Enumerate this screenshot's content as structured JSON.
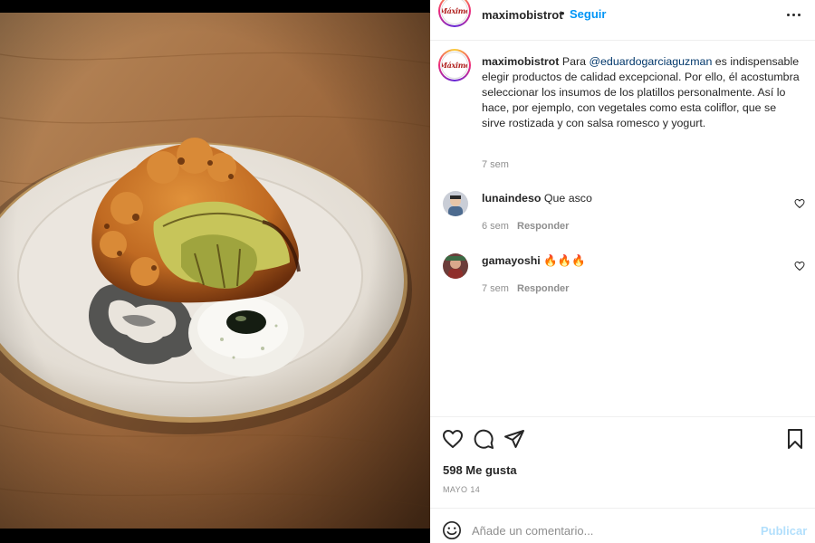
{
  "post": {
    "username": "maximobistrot",
    "separator": "•",
    "follow_label": "Seguir",
    "logo_text": "Máximo",
    "caption": {
      "username": "maximobistrot",
      "text_before": "Para ",
      "mention": "@eduardogarciaguzman",
      "text_after": " es indispensable elegir productos de calidad excepcional. Por ello, él acostumbra seleccionar los insumos de los platillos personalmente. Así lo hace, por ejemplo, con vegetales como esta coliflor, que se sirve rostizada y con salsa romesco y yogurt.",
      "time": "7 sem"
    },
    "comments": [
      {
        "username": "lunaindeso",
        "text": "Que asco",
        "time": "6 sem",
        "reply_label": "Responder"
      },
      {
        "username": "gamayoshi",
        "text": "🔥🔥🔥",
        "time": "7 sem",
        "reply_label": "Responder"
      }
    ],
    "likes": "598 Me gusta",
    "date": "MAYO 14",
    "comment_placeholder": "Añade un comentario...",
    "publish_label": "Publicar"
  },
  "icons": {
    "like": "heart-icon",
    "comment": "comment-icon",
    "share": "paper-plane-icon",
    "save": "bookmark-icon",
    "emoji": "smiley-icon",
    "options": "more-options-icon"
  },
  "colors": {
    "link": "#0095f6",
    "mention": "#00376b",
    "muted": "#8e8e8e",
    "publish_disabled": "#b2dffc"
  }
}
